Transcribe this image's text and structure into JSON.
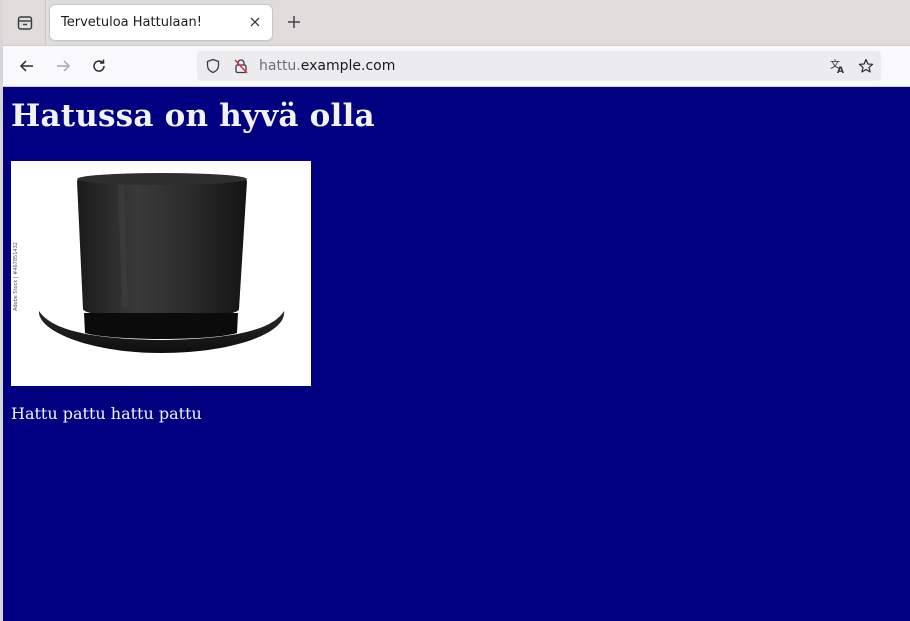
{
  "browser": {
    "tab": {
      "title": "Tervetuloa Hattulaan!"
    },
    "url": {
      "subdomain": "hattu.",
      "domain": "example.com"
    },
    "icons": {
      "tab_overview": "tab-list-icon",
      "close": "close-icon",
      "new_tab": "plus-icon",
      "back": "back-arrow-icon",
      "forward": "forward-arrow-icon",
      "reload": "reload-icon",
      "shield": "tracking-shield-icon",
      "insecure": "insecure-lock-icon",
      "translate": "translate-icon",
      "bookmark": "star-icon"
    }
  },
  "page": {
    "heading": "Hatussa on hyvä olla",
    "image_watermark": "Adobe Stock | #467851432",
    "caption": "Hattu pattu hattu pattu",
    "background_color": "#000080",
    "text_color": "#f2f2f2"
  }
}
